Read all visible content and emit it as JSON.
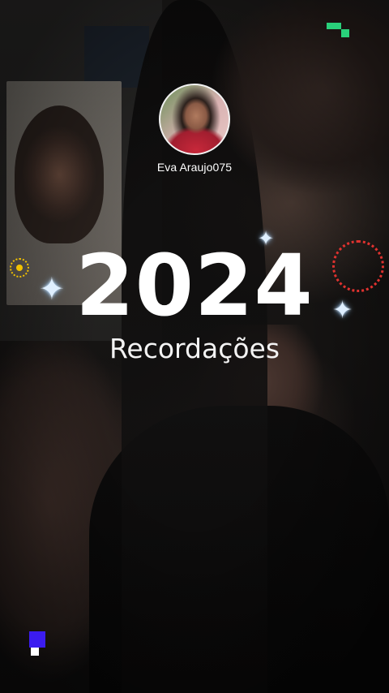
{
  "profile": {
    "username": "Eva Araujo075",
    "avatar_icon": "profile-photo"
  },
  "title": {
    "year": "2024",
    "subtitle": "Recordações"
  },
  "decorations": {
    "sparkle_glyph": "✦",
    "sparkle_color": "#dfefff",
    "sun_color": "#f2c200",
    "ring_color": "#e0322f",
    "corner_top_color": "#29d07a",
    "corner_bottom_color": "#3b1cf0"
  }
}
